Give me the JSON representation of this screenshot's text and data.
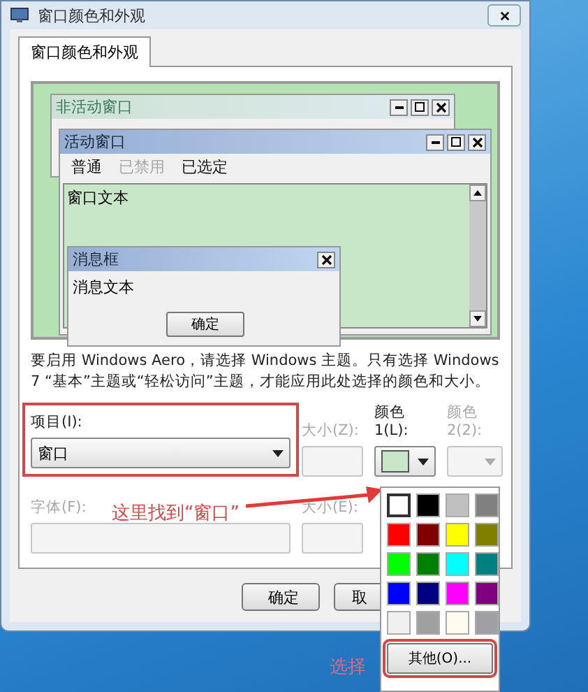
{
  "window": {
    "title": "窗口颜色和外观"
  },
  "tabs": [
    {
      "label": "窗口颜色和外观",
      "selected": true
    }
  ],
  "preview": {
    "inactive_window": {
      "title": "非活动窗口"
    },
    "active_window": {
      "title": "活动窗口",
      "menu": [
        {
          "label": "普通",
          "disabled": false
        },
        {
          "label": "已禁用",
          "disabled": true
        },
        {
          "label": "已选定",
          "disabled": false
        }
      ],
      "text": "窗口文本"
    },
    "message_box": {
      "title": "消息框",
      "text": "消息文本",
      "button": "确定"
    }
  },
  "note": "要启用 Windows Aero，请选择 Windows 主题。只有选择 Windows 7 “基本”主题或“轻松访问”主题，才能应用此处选择的颜色和大小。",
  "item": {
    "label": "项目(I):",
    "value": "窗口"
  },
  "item_size": {
    "label": "大小(Z):",
    "disabled": true
  },
  "color1": {
    "label_lines": [
      "颜色",
      "1(L):"
    ],
    "disabled": false,
    "color": "#c8e6c8"
  },
  "color2": {
    "label_lines": [
      "颜色",
      "2(2):"
    ],
    "disabled": true
  },
  "font": {
    "label": "字体(F):",
    "disabled": true
  },
  "font_size": {
    "label": "大小(E):",
    "disabled": true
  },
  "buttons": [
    {
      "label": "确定"
    },
    {
      "label": "取"
    }
  ],
  "palette": {
    "swatches": [
      {
        "color": "#ffffff",
        "selected": true
      },
      {
        "color": "#000000",
        "selected": false
      },
      {
        "color": "#c0c0c0",
        "selected": false
      },
      {
        "color": "#808080",
        "selected": false
      },
      {
        "color": "#ff0000",
        "selected": false
      },
      {
        "color": "#800000",
        "selected": false
      },
      {
        "color": "#ffff00",
        "selected": false
      },
      {
        "color": "#808000",
        "selected": false
      },
      {
        "color": "#00ff00",
        "selected": false
      },
      {
        "color": "#008000",
        "selected": false
      },
      {
        "color": "#00ffff",
        "selected": false
      },
      {
        "color": "#008080",
        "selected": false
      },
      {
        "color": "#0000ff",
        "selected": false
      },
      {
        "color": "#000080",
        "selected": false
      },
      {
        "color": "#ff00ff",
        "selected": false
      },
      {
        "color": "#800080",
        "selected": false
      },
      {
        "color": "#f0f0f0",
        "selected": false
      },
      {
        "color": "#a0a0a0",
        "selected": false
      },
      {
        "color": "#fffbf0",
        "selected": false
      },
      {
        "color": "#a0a0a4",
        "selected": false
      }
    ],
    "other_button": "其他(O)..."
  },
  "annotations": [
    {
      "kind": "arrow",
      "text": "这里找到“窗口”"
    },
    {
      "kind": "box",
      "text": "选择"
    }
  ]
}
